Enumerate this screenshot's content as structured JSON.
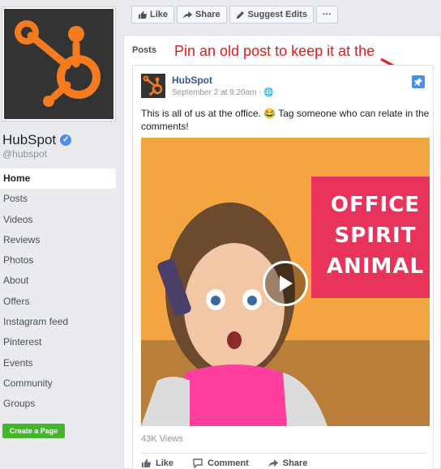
{
  "page": {
    "name": "HubSpot",
    "handle": "@hubspot"
  },
  "nav": [
    {
      "label": "Home",
      "active": true
    },
    {
      "label": "Posts"
    },
    {
      "label": "Videos"
    },
    {
      "label": "Reviews"
    },
    {
      "label": "Photos"
    },
    {
      "label": "About"
    },
    {
      "label": "Offers"
    },
    {
      "label": "Instagram feed"
    },
    {
      "label": "Pinterest"
    },
    {
      "label": "Events"
    },
    {
      "label": "Community"
    },
    {
      "label": "Groups"
    }
  ],
  "create_page_label": "Create a Page",
  "action_bar": {
    "like": "Like",
    "share": "Share",
    "suggest": "Suggest Edits",
    "more": "···"
  },
  "posts": {
    "section_label": "Posts",
    "annotation": "Pin an old post to keep it at the top of your page",
    "post": {
      "author": "HubSpot",
      "date": "September 2 at 9:20am · ",
      "text": "This is all of us at the office. 😂 Tag someone who can relate in the comments!",
      "video_caption": [
        "OFFICE",
        "SPIRIT",
        "ANIMAL"
      ],
      "views": "43K Views",
      "actions": {
        "like": "Like",
        "comment": "Comment",
        "share": "Share"
      }
    }
  },
  "colors": {
    "brand_orange": "#f57b20",
    "verified_blue": "#4a90e2",
    "create_green": "#42b72a",
    "annotation_red": "#e21b1b"
  }
}
